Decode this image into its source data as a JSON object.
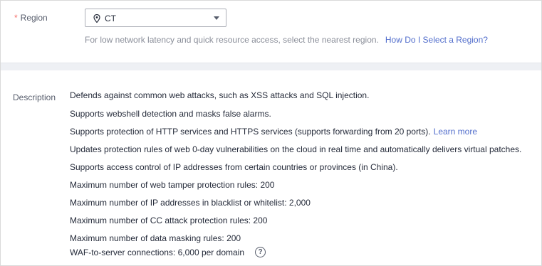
{
  "region": {
    "required_mark": "*",
    "label": "Region",
    "selected_value": "CT",
    "hint": "For low network latency and quick resource access, select the nearest region.",
    "help_link": "How Do I Select a Region?"
  },
  "description": {
    "label": "Description",
    "lines": [
      "Defends against common web attacks, such as XSS attacks and SQL injection.",
      "Supports webshell detection and masks false alarms.",
      "Supports protection of HTTP services and HTTPS services (supports forwarding from 20 ports).",
      "Updates protection rules of web 0-day vulnerabilities on the cloud in real time and automatically delivers virtual patches.",
      "Supports access control of IP addresses from certain countries or provinces (in China).",
      "Maximum number of web tamper protection rules: 200",
      "Maximum number of IP addresses in blacklist or whitelist: 2,000",
      "Maximum number of CC attack protection rules: 200",
      "Maximum number of data masking rules: 200",
      "WAF-to-server connections: 6,000 per domain"
    ],
    "learn_more": "Learn more",
    "help_icon_glyph": "?"
  },
  "icons": {
    "location": "location-pin-icon",
    "dropdown": "chevron-down-icon",
    "help": "question-circle-icon"
  },
  "colors": {
    "required": "#f66f6a",
    "link": "#526ecc",
    "hint": "#8a8e99",
    "band": "#eef0f4"
  }
}
